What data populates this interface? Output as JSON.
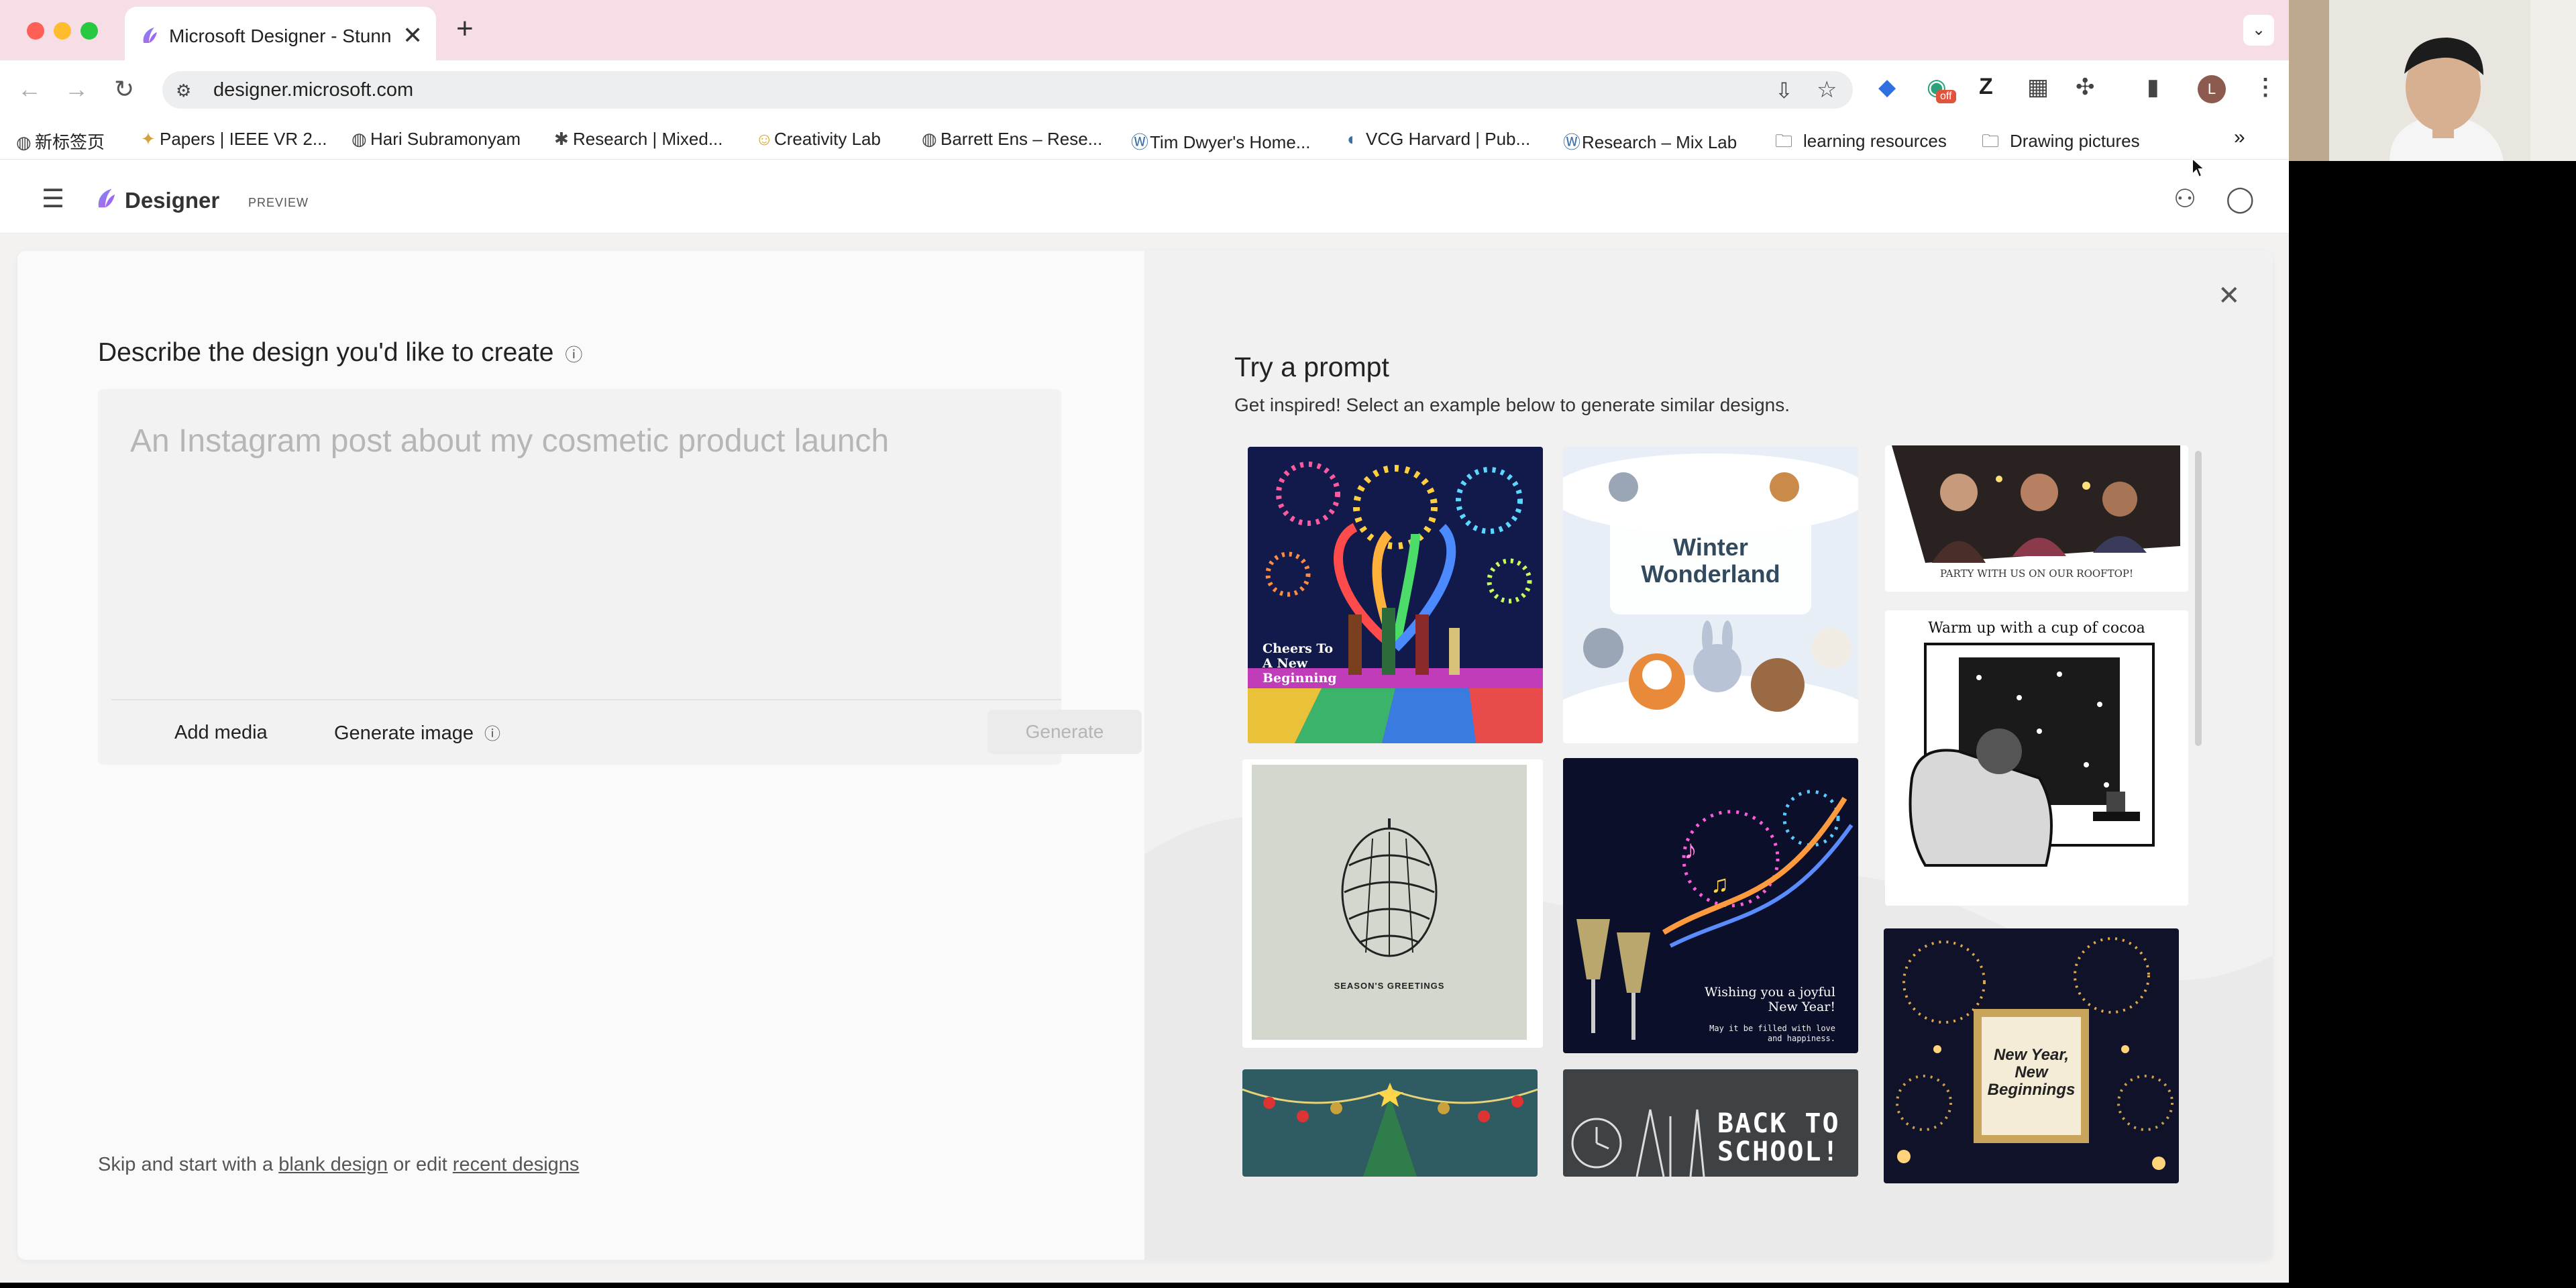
{
  "browser": {
    "tab_title": "Microsoft Designer - Stunning",
    "url": "designer.microsoft.com",
    "bookmarks": [
      {
        "label": "新标签页",
        "icon": "globe-icon"
      },
      {
        "label": "Papers | IEEE VR 2...",
        "icon": "ieee-icon"
      },
      {
        "label": "Hari Subramonyam",
        "icon": "globe-icon"
      },
      {
        "label": "Research | Mixed...",
        "icon": "spider-icon"
      },
      {
        "label": "Creativity Lab",
        "icon": "emoji-icon"
      },
      {
        "label": "Barrett Ens – Rese...",
        "icon": "globe-icon"
      },
      {
        "label": "Tim Dwyer's Home...",
        "icon": "wordpress-icon"
      },
      {
        "label": "VCG Harvard | Pub...",
        "icon": "vcg-icon"
      },
      {
        "label": "Research – Mix Lab",
        "icon": "wordpress-icon"
      },
      {
        "label": "learning resources",
        "icon": "folder-icon"
      },
      {
        "label": "Drawing pictures",
        "icon": "folder-icon"
      }
    ],
    "extension_badge": "off",
    "profile_initial": "L"
  },
  "app": {
    "name": "Designer",
    "badge": "PREVIEW"
  },
  "left": {
    "heading": "Describe the design you'd like to create",
    "placeholder": "An Instagram post about my cosmetic product launch",
    "add_media": "Add media",
    "generate_image": "Generate image",
    "generate": "Generate",
    "skip_prefix": "Skip and start with a",
    "blank_design": "blank design",
    "skip_middle": "or edit",
    "recent_designs": "recent designs"
  },
  "right": {
    "title": "Try a prompt",
    "subtitle": "Get inspired! Select an example below to generate similar designs.",
    "cards": {
      "fireworks": [
        "Cheers To",
        "A New",
        "Beginning"
      ],
      "winter": [
        "Winter",
        "Wonderland"
      ],
      "party": "PARTY WITH US ON OUR ROOFTOP!",
      "cocoa": "Warm up with a cup of cocoa",
      "pinecone": "SEASON'S GREETINGS",
      "newyear_main": "Wishing you a joyful New Year!",
      "newyear_sub": [
        "May it be filled with love",
        "and happiness."
      ],
      "beginnings": [
        "New Year,",
        "New",
        "Beginnings"
      ],
      "school": [
        "BACK TO",
        "SCHOOL!"
      ]
    }
  },
  "colors": {
    "tabbar": "#f6dde6",
    "accent": "#7b5cd6"
  }
}
